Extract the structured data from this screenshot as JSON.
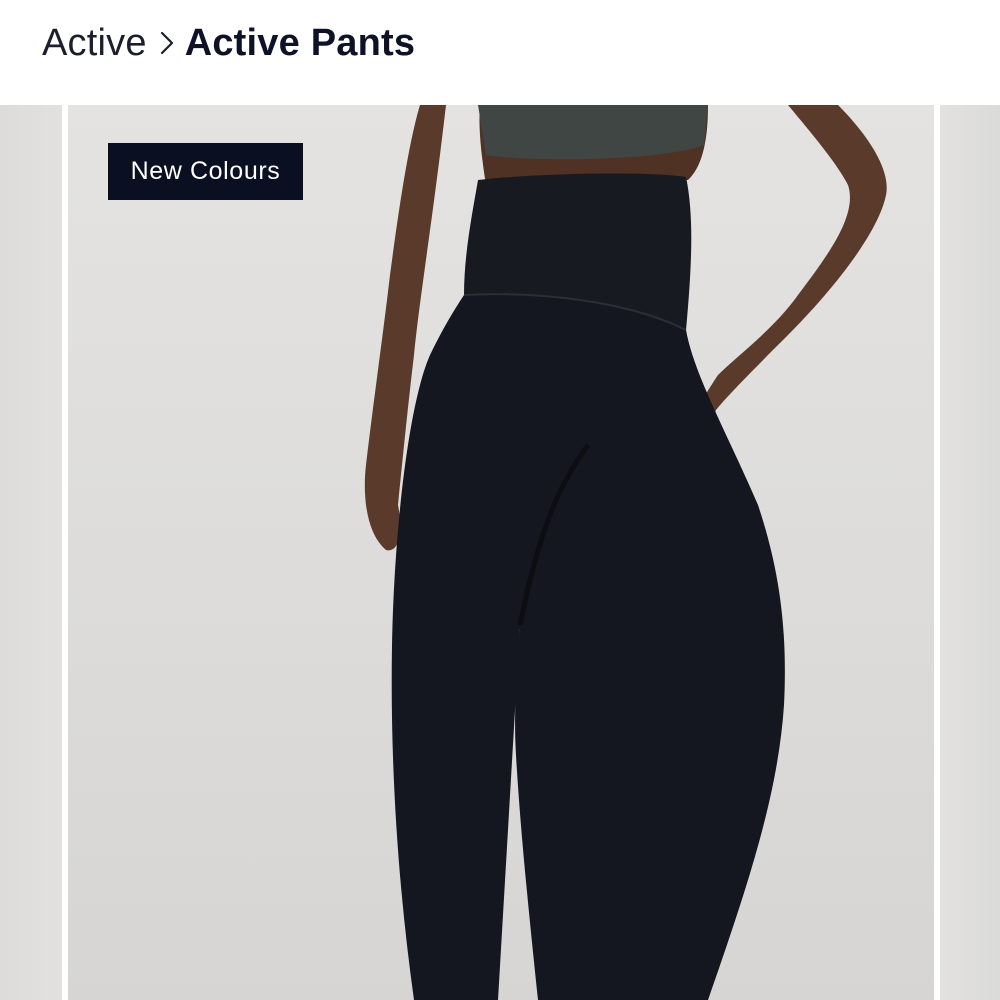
{
  "breadcrumb": {
    "parent_label": "Active",
    "current_label": "Active Pants",
    "separator_icon": "chevron-right-icon"
  },
  "gallery": {
    "badge_label": "New Colours",
    "badge_color": "#0b0f22",
    "image_alt": "Model wearing black flared active pants and a dark green sports bra"
  },
  "colors": {
    "text_primary": "#0d1226",
    "background": "#ffffff",
    "photo_backdrop": "#e0dfdd"
  }
}
